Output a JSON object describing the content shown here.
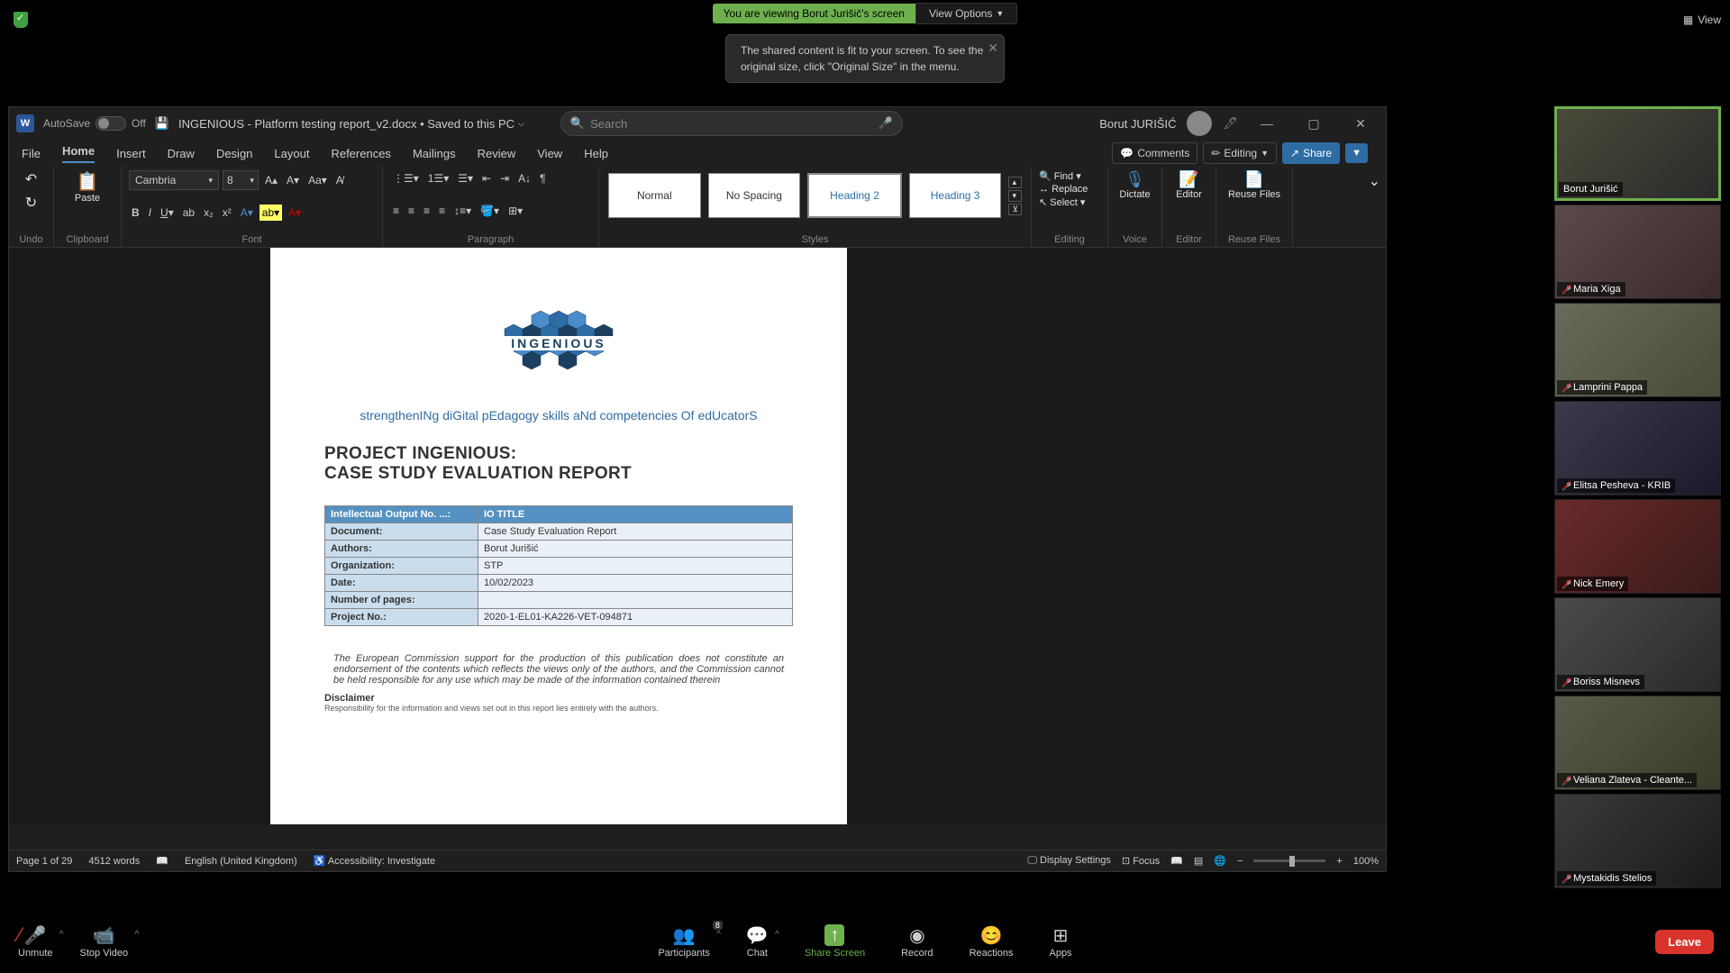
{
  "zoom": {
    "share_banner": "You are viewing Borut Jurišič's screen",
    "view_options": "View Options",
    "view_btn": "View",
    "toast": "The shared content is fit to your screen. To see the original size, click \"Original Size\" in the menu.",
    "controls": {
      "unmute": "Unmute",
      "stop_video": "Stop Video",
      "participants": "Participants",
      "participants_count": "8",
      "chat": "Chat",
      "share_screen": "Share Screen",
      "record": "Record",
      "reactions": "Reactions",
      "apps": "Apps",
      "leave": "Leave"
    },
    "participants": [
      {
        "name": "Borut Jurišić",
        "muted": false,
        "speaking": true
      },
      {
        "name": "Maria Xiga",
        "muted": true,
        "speaking": false
      },
      {
        "name": "Lamprini Pappa",
        "muted": true,
        "speaking": false
      },
      {
        "name": "Elitsa Pesheva - KRIB",
        "muted": true,
        "speaking": false
      },
      {
        "name": "Nick Emery",
        "muted": true,
        "speaking": false
      },
      {
        "name": "Boriss Misnevs",
        "muted": true,
        "speaking": false
      },
      {
        "name": "Veliana Zlateva - Cleante...",
        "muted": true,
        "speaking": false
      },
      {
        "name": "Mystakidis Stelios",
        "muted": true,
        "speaking": false
      }
    ]
  },
  "word": {
    "autosave_label": "AutoSave",
    "autosave_state": "Off",
    "doc_title": "INGENIOUS - Platform testing report_v2.docx • Saved to this PC",
    "search_placeholder": "Search",
    "user": "Borut JURIŠIĆ",
    "tabs": [
      "File",
      "Home",
      "Insert",
      "Draw",
      "Design",
      "Layout",
      "References",
      "Mailings",
      "Review",
      "View",
      "Help"
    ],
    "active_tab": "Home",
    "comments": "Comments",
    "editing_mode": "Editing",
    "share": "Share",
    "ribbon": {
      "undo": "Undo",
      "clipboard": "Clipboard",
      "paste": "Paste",
      "font": "Font",
      "font_name": "Cambria",
      "font_size": "8",
      "paragraph": "Paragraph",
      "styles": "Styles",
      "style_list": [
        "Normal",
        "No Spacing",
        "Heading 2",
        "Heading 3"
      ],
      "editing": "Editing",
      "find": "Find",
      "replace": "Replace",
      "select": "Select",
      "dictate": "Dictate",
      "voice": "Voice",
      "editor": "Editor",
      "reuse_files": "Reuse Files"
    },
    "status": {
      "page": "Page 1 of 29",
      "words": "4512 words",
      "lang": "English (United Kingdom)",
      "accessibility": "Accessibility: Investigate",
      "display_settings": "Display Settings",
      "focus": "Focus",
      "zoom": "100%"
    }
  },
  "document": {
    "logo_text": "INGENIOUS",
    "tagline": "strengthenINg diGital pEdagogy skills aNd competencies Of edUcatorS",
    "title1": "PROJECT INGENIOUS:",
    "title2": "CASE STUDY EVALUATION REPORT",
    "table": {
      "header_left": "Intellectual Output No. ...:",
      "header_right": "IO TITLE",
      "rows": [
        {
          "label": "Document:",
          "value": "Case Study Evaluation Report"
        },
        {
          "label": "Authors:",
          "value": "Borut Jurišić"
        },
        {
          "label": "Organization:",
          "value": "STP"
        },
        {
          "label": "Date:",
          "value": "10/02/2023"
        },
        {
          "label": "Number of pages:",
          "value": ""
        },
        {
          "label": "Project No.:",
          "value": "2020-1-EL01-KA226-VET-094871"
        }
      ]
    },
    "ec_disclaimer": "The European Commission support for the production of this publication does not constitute an endorsement of the contents which reflects the views only of the authors, and the Commission cannot be held responsible for any use which may be made of the information contained therein",
    "disclaimer_h": "Disclaimer",
    "disclaimer_body": "Responsibility for the information and views set out in this report lies entirely with the authors."
  }
}
